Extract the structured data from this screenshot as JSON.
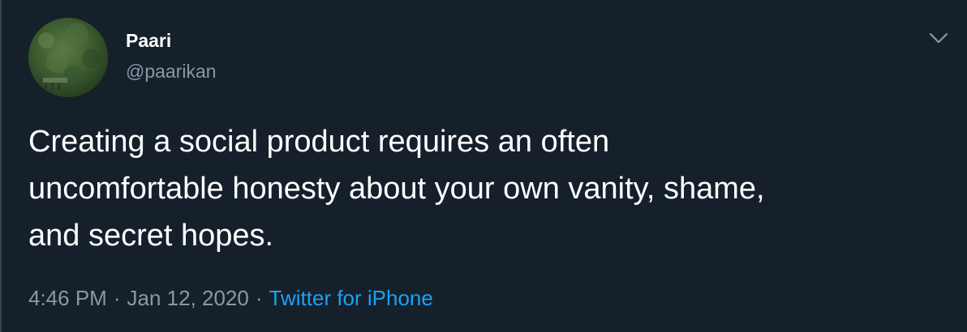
{
  "tweet": {
    "author": {
      "name": "Paari",
      "handle": "@paarikan"
    },
    "text": "Creating a social product requires an often\nuncomfortable honesty about your own vanity, shame,\nand secret hopes.",
    "time": "4:46 PM",
    "separator": "·",
    "date": "Jan 12, 2020",
    "source": "Twitter for iPhone"
  },
  "icons": {
    "menu": "chevron-down-icon"
  },
  "colors": {
    "background": "#15202b",
    "text": "#ffffff",
    "secondary_text": "#8899a6",
    "link": "#1da1f2",
    "border": "#38444d"
  }
}
